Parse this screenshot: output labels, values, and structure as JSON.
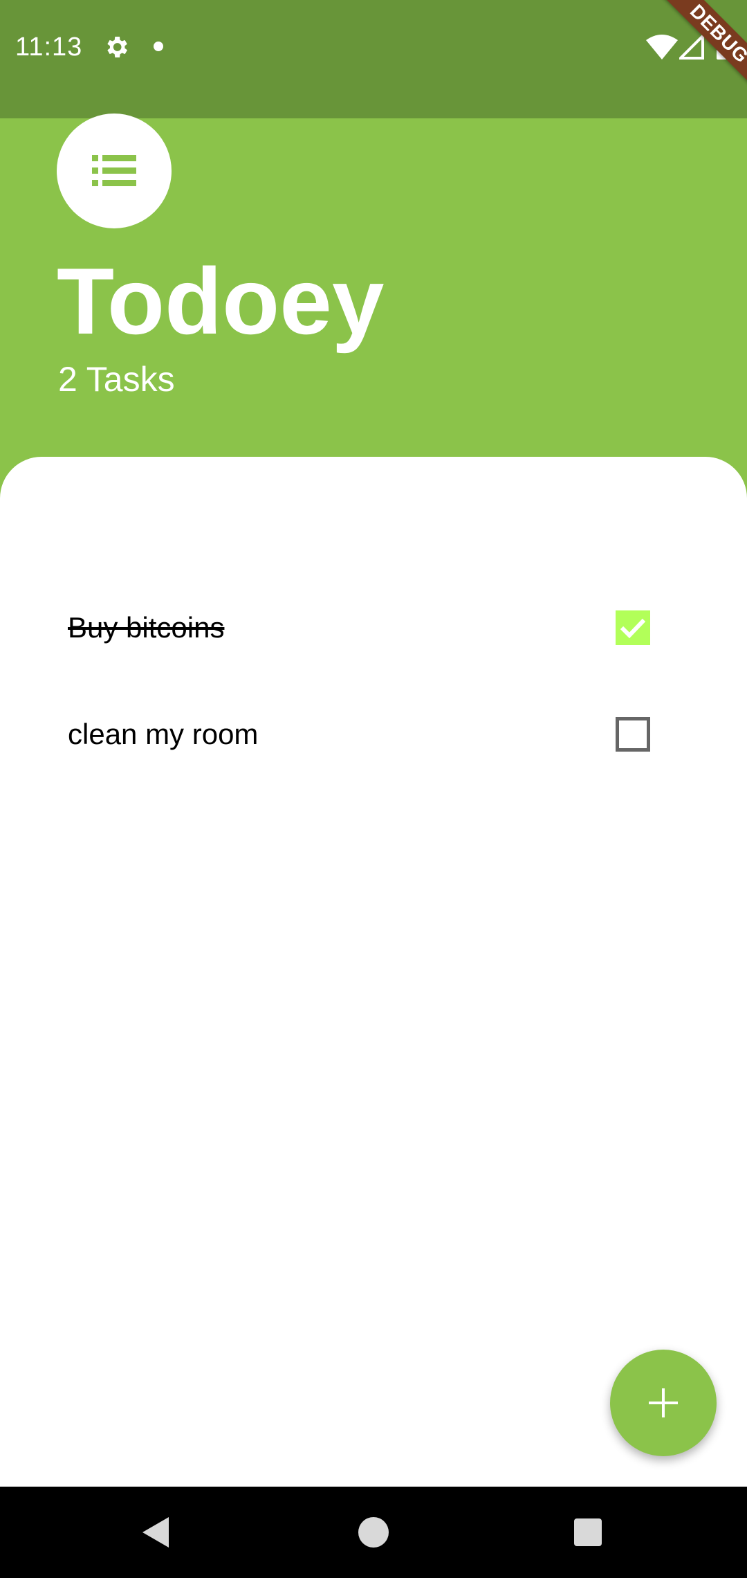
{
  "status_bar": {
    "time": "11:13",
    "icons": [
      "gear-icon",
      "notification-dot-icon",
      "wifi-icon",
      "signal-icon",
      "battery-icon"
    ]
  },
  "debug_banner": "DEBUG",
  "header": {
    "icon": "list-icon",
    "title": "Todoey",
    "task_count": "2 Tasks"
  },
  "tasks": [
    {
      "label": "Buy bitcoins",
      "done": true
    },
    {
      "label": "clean my room",
      "done": false
    }
  ],
  "fab": {
    "icon": "plus-icon"
  },
  "nav_bar": {
    "icons": [
      "back-icon",
      "home-icon",
      "recents-icon"
    ]
  },
  "colors": {
    "primary": "#8bc34a",
    "status_bar": "#689539",
    "checkbox_checked": "#b2ff59",
    "checkbox_border": "#666666",
    "debug_banner": "#7a3b1f"
  }
}
